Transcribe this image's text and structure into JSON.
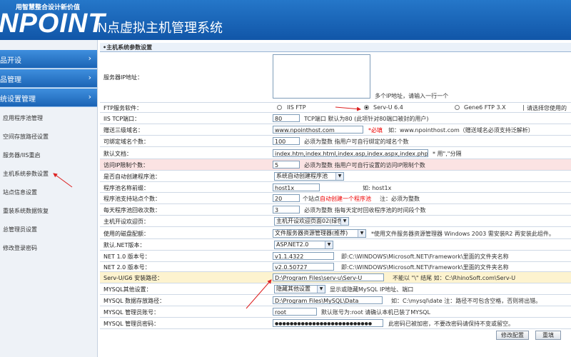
{
  "header": {
    "slogan": "用智慧整合设计新价值",
    "logo": "NPOINT",
    "title": "N点虚拟主机管理系统"
  },
  "sidebar": {
    "sections": [
      {
        "label": "品开设"
      },
      {
        "label": "品管理"
      },
      {
        "label": "统设置管理"
      }
    ],
    "items": [
      {
        "label": "应用程序池管理"
      },
      {
        "label": "空间存放路径设置"
      },
      {
        "label": "服务器/IIS重启"
      },
      {
        "label": "主机系统参数设置"
      },
      {
        "label": "站点信息设置"
      },
      {
        "label": "重装系统数据恢复"
      },
      {
        "label": "总管理员设置"
      },
      {
        "label": "修改登录密码"
      }
    ]
  },
  "main": {
    "section_title": "•主机系统参数设置",
    "server_ip": {
      "label": "服务器IP地址：",
      "hint": "多个IP地址，请输入一行一个"
    },
    "ftp": {
      "label": "FTP服务软件：",
      "options": [
        {
          "label": "IIS FTP",
          "selected": false
        },
        {
          "label": "Serv-U 6.4",
          "selected": true
        },
        {
          "label": "Gene6 FTP 3.X",
          "selected": false
        }
      ],
      "hint": "请选择您使用的"
    },
    "iis_port": {
      "label": "IIS TCP端口：",
      "value": "80",
      "note": "TCP端口 默认为80 (此项针对80端口被封的用户)"
    },
    "gift_domain": {
      "label": "赠送三级域名：",
      "value": "www.npointhost.com",
      "required": "*必填",
      "note": "如：www.npointhost.com（赠送域名必须支持泛解析）"
    },
    "bind_count": {
      "label": "可绑定域名个数：",
      "value": "100",
      "note": "必须为整数 指用户可自行绑定的域名个数"
    },
    "default_doc": {
      "label": "默认文档：",
      "value": "index.htm,index.html,index.asp,index.aspx,index.php",
      "note": "* 用\",\"分隔"
    },
    "visit_ip": {
      "label": "访问IP限制个数：",
      "value": "5",
      "note": "必须为整数 指用户可自行设置的访问IP限制个数"
    },
    "auto_pool": {
      "label": "是否自动创建程序池：",
      "value": "系统自动创建程序池"
    },
    "pool_prefix": {
      "label": "程序池名称前缀：",
      "value": "host1x",
      "note": "如: host1x"
    },
    "pool_sites": {
      "label": "程序池支持站点个数：",
      "value": "20",
      "note_pre": "个站点",
      "note_red": "自动创建一个程序池",
      "note_post": "注：必须为整数"
    },
    "pool_recycle": {
      "label": "每天程序池回收次数：",
      "value": "3",
      "note": "必须为整数 指每天定时回收程序池的时间段个数"
    },
    "default_page": {
      "label": "主机开设欢迎页：",
      "value": "主机开设欢迎页面02(绿色)"
    },
    "disk_quota": {
      "label": "使用的磁盘配额：",
      "value": "文件服务器资源管理器(推荐)",
      "note": "*使用文件服务器资源管理器 Windows 2003 需安装R2 再安装此组件。"
    },
    "net_default": {
      "label": "默认.NET版本：",
      "value": "ASP.NET2.0"
    },
    "net1": {
      "label": "NET 1.0 版本号：",
      "value": "v1.1.4322",
      "note": "即:C:\\WINDOWS\\Microsoft.NET\\Framework\\里面的文件夹名称"
    },
    "net2": {
      "label": "NET 2.0 版本号：",
      "value": "v2.0.50727",
      "note": "即:C:\\WINDOWS\\Microsoft.NET\\Framework\\里面的文件夹名称"
    },
    "servu_path": {
      "label": "Serv-U/G6 安装路径：",
      "value": "D:\\Program Files\\serv-u\\Serv-U",
      "note": "不能以 \"\\\" 结尾  如：C:\\RhinoSoft.com\\Serv-U"
    },
    "mysql_other": {
      "label": "MYSQL其他设置：",
      "value": "隐藏其他设置",
      "note": "显示或隐藏MySQL IP地址、端口"
    },
    "mysql_path": {
      "label": "MYSQL 数据存放路径：",
      "value": "D:\\Program Files\\MySQL\\Data",
      "note": "如：C:\\mysql\\date  注：路径不可包含空格，否则将出错。"
    },
    "mysql_user": {
      "label": "MYSQL 管理员账号：",
      "value": "root",
      "note": "默认账号为:root   请确认本机已装了MYSQL"
    },
    "mysql_pass": {
      "label": "MYSQL 管理员密码：",
      "value": "●●●●●●●●●●●●●●●●●●●●●●●●●●",
      "note": "此密码已被加密，不要改密码请保持不变或留空。"
    },
    "buttons": {
      "save": "修改配置",
      "reset": "重填"
    }
  }
}
